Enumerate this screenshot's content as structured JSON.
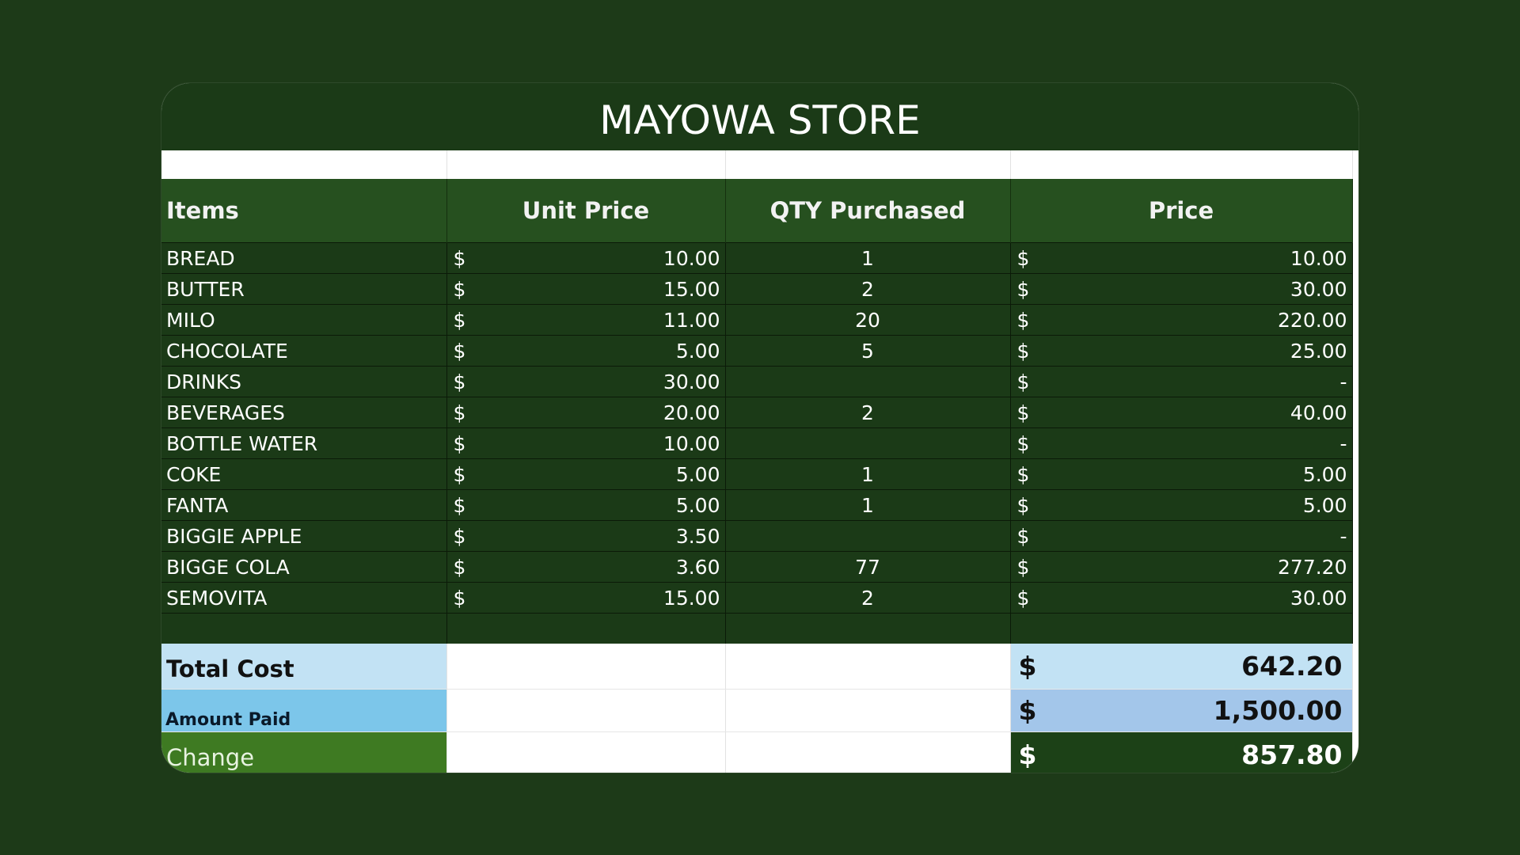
{
  "store": {
    "title": "MAYOWA STORE"
  },
  "headers": {
    "items": "Items",
    "unit_price": "Unit Price",
    "qty": "QTY Purchased",
    "price": "Price"
  },
  "rows": [
    {
      "item": "BREAD",
      "currency": "$",
      "unit_price": "10.00",
      "qty": "1",
      "price": "10.00"
    },
    {
      "item": "BUTTER",
      "currency": "$",
      "unit_price": "15.00",
      "qty": "2",
      "price": "30.00"
    },
    {
      "item": "MILO",
      "currency": "$",
      "unit_price": "11.00",
      "qty": "20",
      "price": "220.00"
    },
    {
      "item": "CHOCOLATE",
      "currency": "$",
      "unit_price": "5.00",
      "qty": "5",
      "price": "25.00"
    },
    {
      "item": "DRINKS",
      "currency": "$",
      "unit_price": "30.00",
      "qty": "",
      "price": "-"
    },
    {
      "item": "BEVERAGES",
      "currency": "$",
      "unit_price": "20.00",
      "qty": "2",
      "price": "40.00"
    },
    {
      "item": "BOTTLE WATER",
      "currency": "$",
      "unit_price": "10.00",
      "qty": "",
      "price": "-"
    },
    {
      "item": "COKE",
      "currency": "$",
      "unit_price": "5.00",
      "qty": "1",
      "price": "5.00"
    },
    {
      "item": "FANTA",
      "currency": "$",
      "unit_price": "5.00",
      "qty": "1",
      "price": "5.00"
    },
    {
      "item": "BIGGIE APPLE",
      "currency": "$",
      "unit_price": "3.50",
      "qty": "",
      "price": "-"
    },
    {
      "item": "BIGGE COLA",
      "currency": "$",
      "unit_price": "3.60",
      "qty": "77",
      "price": "277.20"
    },
    {
      "item": "SEMOVITA",
      "currency": "$",
      "unit_price": "15.00",
      "qty": "2",
      "price": "30.00"
    }
  ],
  "summary": {
    "total_cost": {
      "label": "Total Cost",
      "currency": "$",
      "value": "642.20"
    },
    "amount_paid": {
      "label": "Amount Paid",
      "currency": "$",
      "value": "1,500.00"
    },
    "change": {
      "label": "Change",
      "currency": "$",
      "value": "857.80"
    }
  },
  "colors": {
    "background": "#1d3a18",
    "title_bar": "#1b3a17",
    "header": "#26501f",
    "total_cost_fill": "#c2e2f4",
    "amount_paid_label_fill": "#7cc6ea",
    "amount_paid_value_fill": "#a3c6ea",
    "change_label_fill": "#3e7a22",
    "change_value_fill": "#1c4117"
  }
}
